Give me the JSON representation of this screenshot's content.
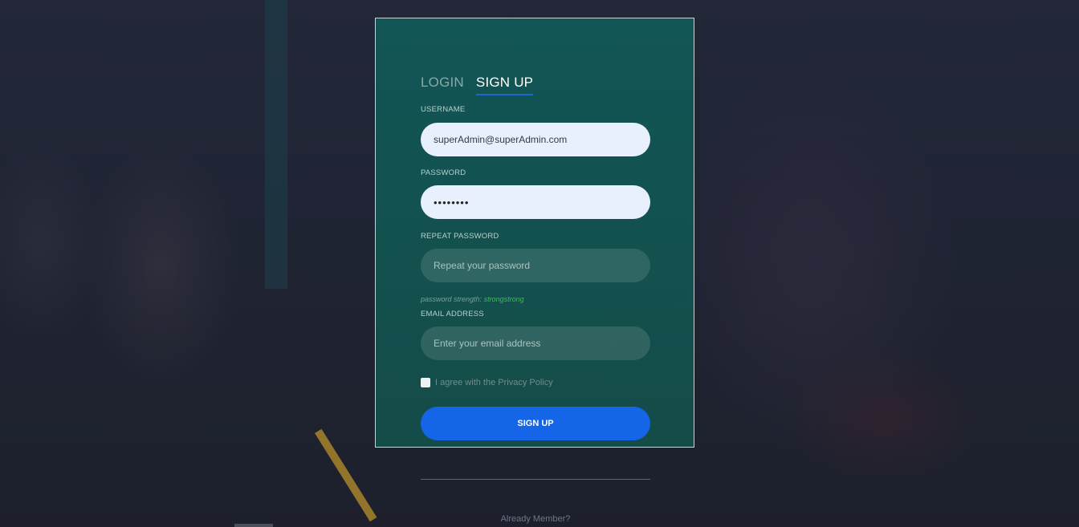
{
  "tabs": {
    "login": "LOGIN",
    "signup": "SIGN UP"
  },
  "username": {
    "label": "USERNAME",
    "value": "superAdmin@superAdmin.com"
  },
  "password": {
    "label": "PASSWORD",
    "value": "••••••••"
  },
  "repeat_password": {
    "label": "REPEAT PASSWORD",
    "placeholder": "Repeat your password"
  },
  "strength": {
    "label": "password strength:",
    "value": "strongstrong"
  },
  "email": {
    "label": "EMAIL ADDRESS",
    "placeholder": "Enter your email address"
  },
  "agree": {
    "label": "I agree with the Privacy Policy"
  },
  "submit_label": "SIGN UP",
  "footer": {
    "already_member": "Already Member?"
  },
  "colors": {
    "accent": "#1565e8",
    "card": "#105a58",
    "strength": "#33c24a"
  }
}
